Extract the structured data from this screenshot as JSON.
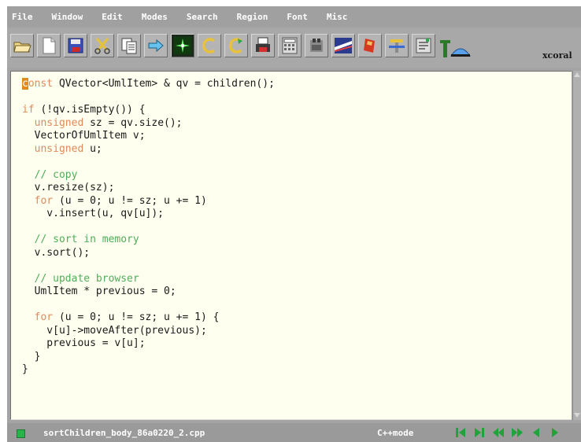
{
  "menu": {
    "items": [
      {
        "label": "File"
      },
      {
        "label": "Window"
      },
      {
        "label": "Edit"
      },
      {
        "label": "Modes"
      },
      {
        "label": "Search"
      },
      {
        "label": "Region"
      },
      {
        "label": "Font"
      },
      {
        "label": "Misc"
      }
    ]
  },
  "toolbar": {
    "buttons": [
      {
        "icon": "open-folder-icon"
      },
      {
        "icon": "new-file-icon"
      },
      {
        "icon": "save-icon"
      },
      {
        "icon": "cut-icon"
      },
      {
        "icon": "copy-icon"
      },
      {
        "icon": "paste-icon"
      },
      {
        "icon": "compile-icon"
      },
      {
        "icon": "undo-icon"
      },
      {
        "icon": "redo-icon"
      },
      {
        "icon": "print-icon"
      },
      {
        "icon": "calculator-icon"
      },
      {
        "icon": "debug-icon"
      },
      {
        "icon": "search-replace-icon"
      },
      {
        "icon": "bookmark-icon"
      },
      {
        "icon": "tools-icon"
      },
      {
        "icon": "terminal-icon"
      }
    ],
    "logo_text": "xcoral"
  },
  "editor": {
    "cursor_char": "c",
    "lines": [
      {
        "segments": [
          {
            "t": "onst",
            "c": "kw"
          },
          {
            "t": " QVector<UmlItem> & qv = children();",
            "c": ""
          }
        ]
      },
      {
        "segments": []
      },
      {
        "segments": [
          {
            "t": "if",
            "c": "kw"
          },
          {
            "t": " (!qv.isEmpty()) {",
            "c": ""
          }
        ]
      },
      {
        "segments": [
          {
            "t": "  ",
            "c": ""
          },
          {
            "t": "unsigned",
            "c": "kw"
          },
          {
            "t": " sz = qv.size();",
            "c": ""
          }
        ]
      },
      {
        "segments": [
          {
            "t": "  VectorOfUmlItem v;",
            "c": ""
          }
        ]
      },
      {
        "segments": [
          {
            "t": "  ",
            "c": ""
          },
          {
            "t": "unsigned",
            "c": "kw"
          },
          {
            "t": " u;",
            "c": ""
          }
        ]
      },
      {
        "segments": []
      },
      {
        "segments": [
          {
            "t": "  ",
            "c": ""
          },
          {
            "t": "// copy",
            "c": "cm"
          }
        ]
      },
      {
        "segments": [
          {
            "t": "  v.resize(sz);",
            "c": ""
          }
        ]
      },
      {
        "segments": [
          {
            "t": "  ",
            "c": ""
          },
          {
            "t": "for",
            "c": "kw"
          },
          {
            "t": " (u = 0; u != sz; u += 1)",
            "c": ""
          }
        ]
      },
      {
        "segments": [
          {
            "t": "    v.insert(u, qv[u]);",
            "c": ""
          }
        ]
      },
      {
        "segments": []
      },
      {
        "segments": [
          {
            "t": "  ",
            "c": ""
          },
          {
            "t": "// sort in memory",
            "c": "cm"
          }
        ]
      },
      {
        "segments": [
          {
            "t": "  v.sort();",
            "c": ""
          }
        ]
      },
      {
        "segments": []
      },
      {
        "segments": [
          {
            "t": "  ",
            "c": ""
          },
          {
            "t": "// update browser",
            "c": "cm"
          }
        ]
      },
      {
        "segments": [
          {
            "t": "  UmlItem * previous = 0;",
            "c": ""
          }
        ]
      },
      {
        "segments": []
      },
      {
        "segments": [
          {
            "t": "  ",
            "c": ""
          },
          {
            "t": "for",
            "c": "kw"
          },
          {
            "t": " (u = 0; u != sz; u += 1) {",
            "c": ""
          }
        ]
      },
      {
        "segments": [
          {
            "t": "    v[u]->moveAfter(previous);",
            "c": ""
          }
        ]
      },
      {
        "segments": [
          {
            "t": "    previous = v[u];",
            "c": ""
          }
        ]
      },
      {
        "segments": [
          {
            "t": "  }",
            "c": ""
          }
        ]
      },
      {
        "segments": [
          {
            "t": "}",
            "c": ""
          }
        ]
      }
    ]
  },
  "status": {
    "filename": "sortChildren_body_86a0220_2.cpp",
    "mode": "C++mode",
    "nav_buttons": [
      {
        "icon": "first-icon"
      },
      {
        "icon": "last-icon"
      },
      {
        "icon": "rewind-icon"
      },
      {
        "icon": "fast-forward-icon"
      },
      {
        "icon": "previous-icon"
      },
      {
        "icon": "next-icon"
      }
    ]
  },
  "colors": {
    "keyword": "#e08a5a",
    "comment": "#4eae5a",
    "editor_bg": "#fffff0",
    "chrome": "#a4a4a4",
    "nav_green": "#1fa33a"
  }
}
